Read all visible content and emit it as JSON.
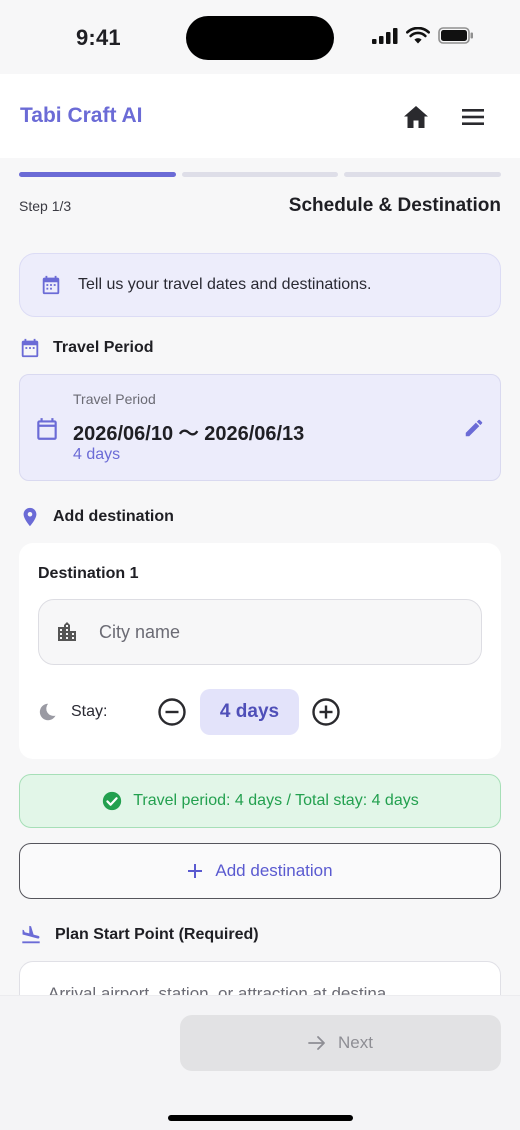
{
  "status_bar": {
    "time": "9:41"
  },
  "header": {
    "app_title": "Tabi Craft AI"
  },
  "progress": {
    "total_steps": 3,
    "current_step": 1
  },
  "step": {
    "label": "Step 1/3",
    "title": "Schedule & Destination"
  },
  "info": {
    "text": "Tell us your travel dates and destinations."
  },
  "travel_period": {
    "section_title": "Travel Period",
    "field_label": "Travel Period",
    "range": "2026/06/10 〜 2026/06/13",
    "days": "4 days"
  },
  "add_destination_section": {
    "title": "Add destination"
  },
  "destination": {
    "title": "Destination 1",
    "city_placeholder": "City name",
    "stay_label": "Stay:",
    "stay_value": "4 days"
  },
  "summary": {
    "text": "Travel period: 4 days / Total stay: 4 days"
  },
  "add_destination_button": {
    "label": "Add destination"
  },
  "plan_start": {
    "section_title": "Plan Start Point (Required)",
    "placeholder": "Arrival airport, station, or attraction at destina"
  },
  "footer": {
    "next_label": "Next"
  },
  "colors": {
    "accent": "#6b6bd6",
    "success": "#23a04f",
    "disabled": "#8e8e94"
  }
}
